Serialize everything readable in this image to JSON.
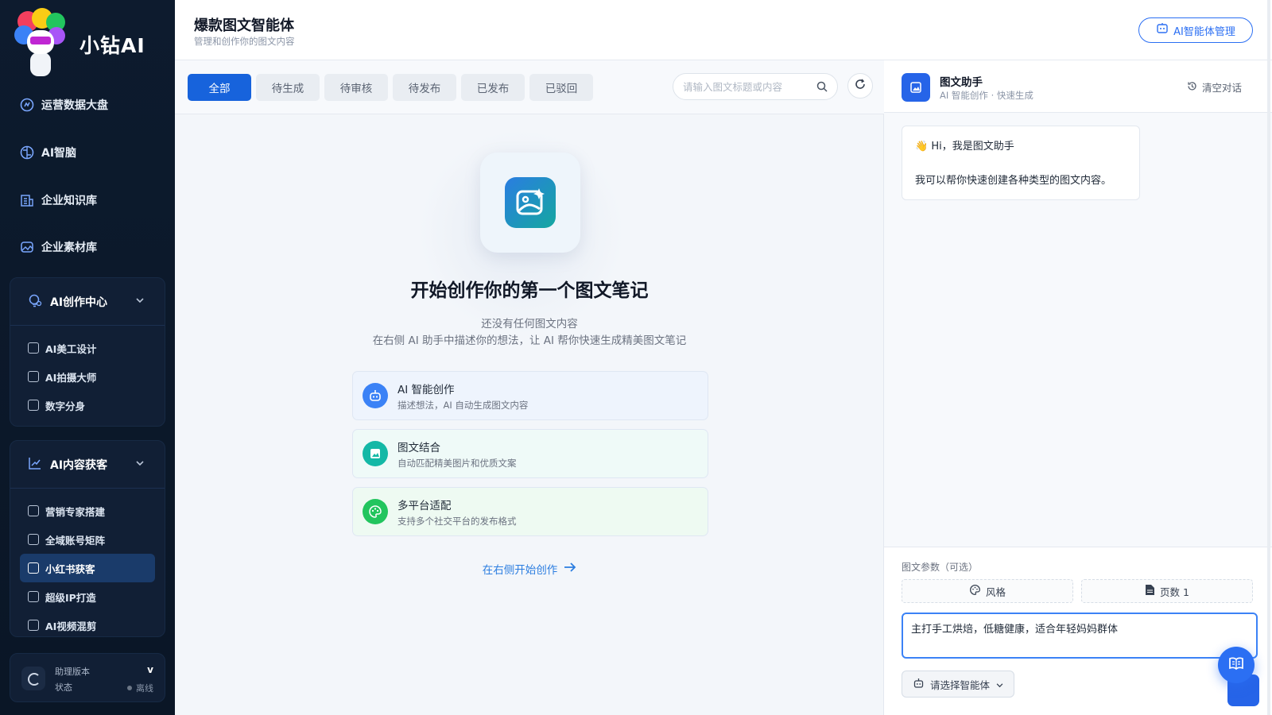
{
  "app": {
    "brand": "小钻AI"
  },
  "sidebar": {
    "items": [
      {
        "label": "运营数据大盘",
        "icon": "dashboard-icon"
      },
      {
        "label": "AI智脑",
        "icon": "brain-icon"
      },
      {
        "label": "企业知识库",
        "icon": "knowledge-icon"
      },
      {
        "label": "企业素材库",
        "icon": "image-icon"
      }
    ],
    "group1": {
      "label": "AI创作中心",
      "items": [
        {
          "label": "AI美工设计",
          "icon": "design-icon"
        },
        {
          "label": "AI拍摄大师",
          "icon": "camera-icon"
        },
        {
          "label": "数字分身",
          "icon": "avatar-icon"
        }
      ]
    },
    "group2": {
      "label": "AI内容获客",
      "items": [
        {
          "label": "营销专家搭建",
          "icon": "user-icon"
        },
        {
          "label": "全域账号矩阵",
          "icon": "document-icon"
        },
        {
          "label": "小红书获客",
          "icon": "ai-note-icon"
        },
        {
          "label": "超级IP打造",
          "icon": "id-icon"
        },
        {
          "label": "AI视频混剪",
          "icon": "video-icon"
        }
      ]
    },
    "status": {
      "label1": "助理版本",
      "version": "v",
      "label2": "状态",
      "state": "离线"
    }
  },
  "header": {
    "title": "爆款图文智能体",
    "subtitle": "管理和创作你的图文内容",
    "agent_button": "AI智能体管理"
  },
  "tabs": [
    "全部",
    "待生成",
    "待审核",
    "待发布",
    "已发布",
    "已驳回"
  ],
  "search": {
    "placeholder": "请输入图文标题或内容"
  },
  "empty_state": {
    "title": "开始创作你的第一个图文笔记",
    "desc1": "还没有任何图文内容",
    "desc2": "在右侧 AI 助手中描述你的想法，让 AI 帮你快速生成精美图文笔记",
    "cta": "在右侧开始创作"
  },
  "features": [
    {
      "title": "AI 智能创作",
      "desc": "描述想法，AI 自动生成图文内容",
      "icon": "robot-icon",
      "color": "#3b82f6"
    },
    {
      "title": "图文结合",
      "desc": "自动匹配精美图片和优质文案",
      "icon": "image-icon",
      "color": "#14b8a6"
    },
    {
      "title": "多平台适配",
      "desc": "支持多个社交平台的发布格式",
      "icon": "palette-icon",
      "color": "#22c55e"
    }
  ],
  "assistant": {
    "name": "图文助手",
    "subtitle": "AI 智能创作 · 快速生成",
    "clear_label": "清空对话",
    "greeting": "Hi，我是图文助手",
    "greeting_emoji": "👋",
    "intro": "我可以帮你快速创建各种类型的图文内容。",
    "params_label": "图文参数（可选）",
    "style_label": "风格",
    "pages_label": "页数 1",
    "input_value": "主打手工烘焙，低糖健康，适合年轻妈妈群体",
    "agent_select": "请选择智能体"
  },
  "colors": {
    "primary": "#1763dc",
    "sidebar_bg": "#0d1b2e",
    "accent": "#2b6ff3"
  }
}
